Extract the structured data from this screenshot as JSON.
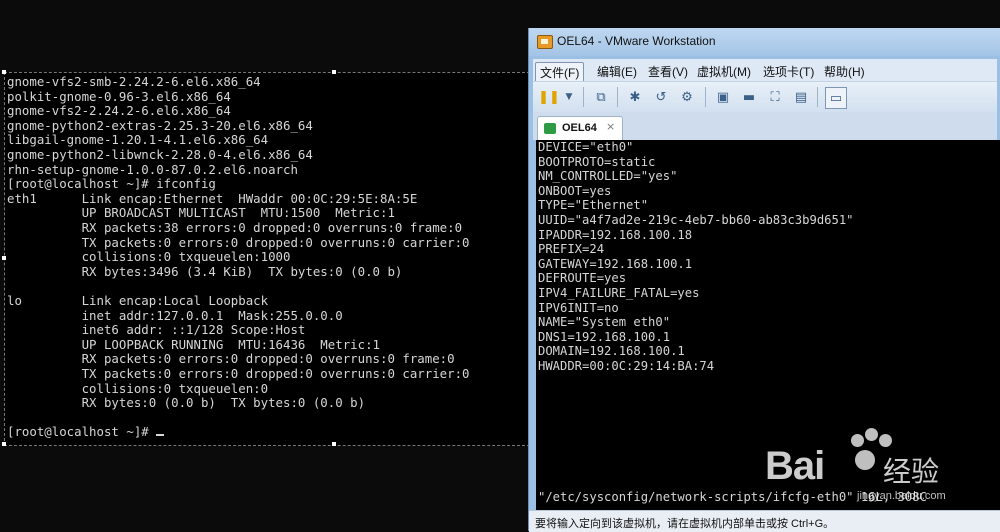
{
  "left_terminal": {
    "lines": [
      "gnome-vfs2-smb-2.24.2-6.el6.x86_64",
      "polkit-gnome-0.96-3.el6.x86_64",
      "gnome-vfs2-2.24.2-6.el6.x86_64",
      "gnome-python2-extras-2.25.3-20.el6.x86_64",
      "libgail-gnome-1.20.1-4.1.el6.x86_64",
      "gnome-python2-libwnck-2.28.0-4.el6.x86_64",
      "rhn-setup-gnome-1.0.0-87.0.2.el6.noarch",
      "[root@localhost ~]# ifconfig",
      "eth1      Link encap:Ethernet  HWaddr 00:0C:29:5E:8A:5E",
      "          UP BROADCAST MULTICAST  MTU:1500  Metric:1",
      "          RX packets:38 errors:0 dropped:0 overruns:0 frame:0",
      "          TX packets:0 errors:0 dropped:0 overruns:0 carrier:0",
      "          collisions:0 txqueuelen:1000",
      "          RX bytes:3496 (3.4 KiB)  TX bytes:0 (0.0 b)",
      "",
      "lo        Link encap:Local Loopback",
      "          inet addr:127.0.0.1  Mask:255.0.0.0",
      "          inet6 addr: ::1/128 Scope:Host",
      "          UP LOOPBACK RUNNING  MTU:16436  Metric:1",
      "          RX packets:0 errors:0 dropped:0 overruns:0 frame:0",
      "          TX packets:0 errors:0 dropped:0 overruns:0 carrier:0",
      "          collisions:0 txqueuelen:0",
      "          RX bytes:0 (0.0 b)  TX bytes:0 (0.0 b)",
      "",
      "[root@localhost ~]# "
    ]
  },
  "vm_window": {
    "title": "OEL64 - VMware Workstation",
    "menu": [
      "文件(F)",
      "编辑(E)",
      "查看(V)",
      "虚拟机(M)",
      "选项卡(T)",
      "帮助(H)"
    ],
    "toolbar_icons": [
      "pause-icon",
      "dropdown-icon",
      "network-icon",
      "snapshot-icon",
      "revert-icon",
      "manage-snapshots-icon",
      "console-view-icon",
      "unity-icon",
      "fullscreen-icon",
      "settings-icon",
      "thumbnail-icon"
    ],
    "tab": {
      "label": "OEL64",
      "close": "×"
    },
    "screen_lines": [
      "DEVICE=\"eth0\"",
      "BOOTPROTO=static",
      "NM_CONTROLLED=\"yes\"",
      "ONBOOT=yes",
      "TYPE=\"Ethernet\"",
      "UUID=\"a4f7ad2e-219c-4eb7-bb60-ab83c3b9d651\"",
      "IPADDR=192.168.100.18",
      "PREFIX=24",
      "GATEWAY=192.168.100.1",
      "DEFROUTE=yes",
      "IPV4_FAILURE_FATAL=yes",
      "IPV6INIT=no",
      "NAME=\"System eth0\"",
      "DNS1=192.168.100.1",
      "DOMAIN=192.168.100.1",
      "HWADDR=00:0C:29:14:BA:74"
    ],
    "screen_footer": "\"/etc/sysconfig/network-scripts/ifcfg-eth0\" 16L, 308C",
    "status_text": "要将输入定向到该虚拟机，请在虚拟机内部单击或按 Ctrl+G。"
  },
  "watermark": {
    "brand": "Bai",
    "brand_suffix": "经验",
    "url": "jingyan.baidu.com"
  },
  "colors": {
    "terminal_text": "#d6d6d6",
    "terminal_bg": "#000000",
    "window_frame": "#9cc0e3",
    "accent": "#e79a25"
  }
}
